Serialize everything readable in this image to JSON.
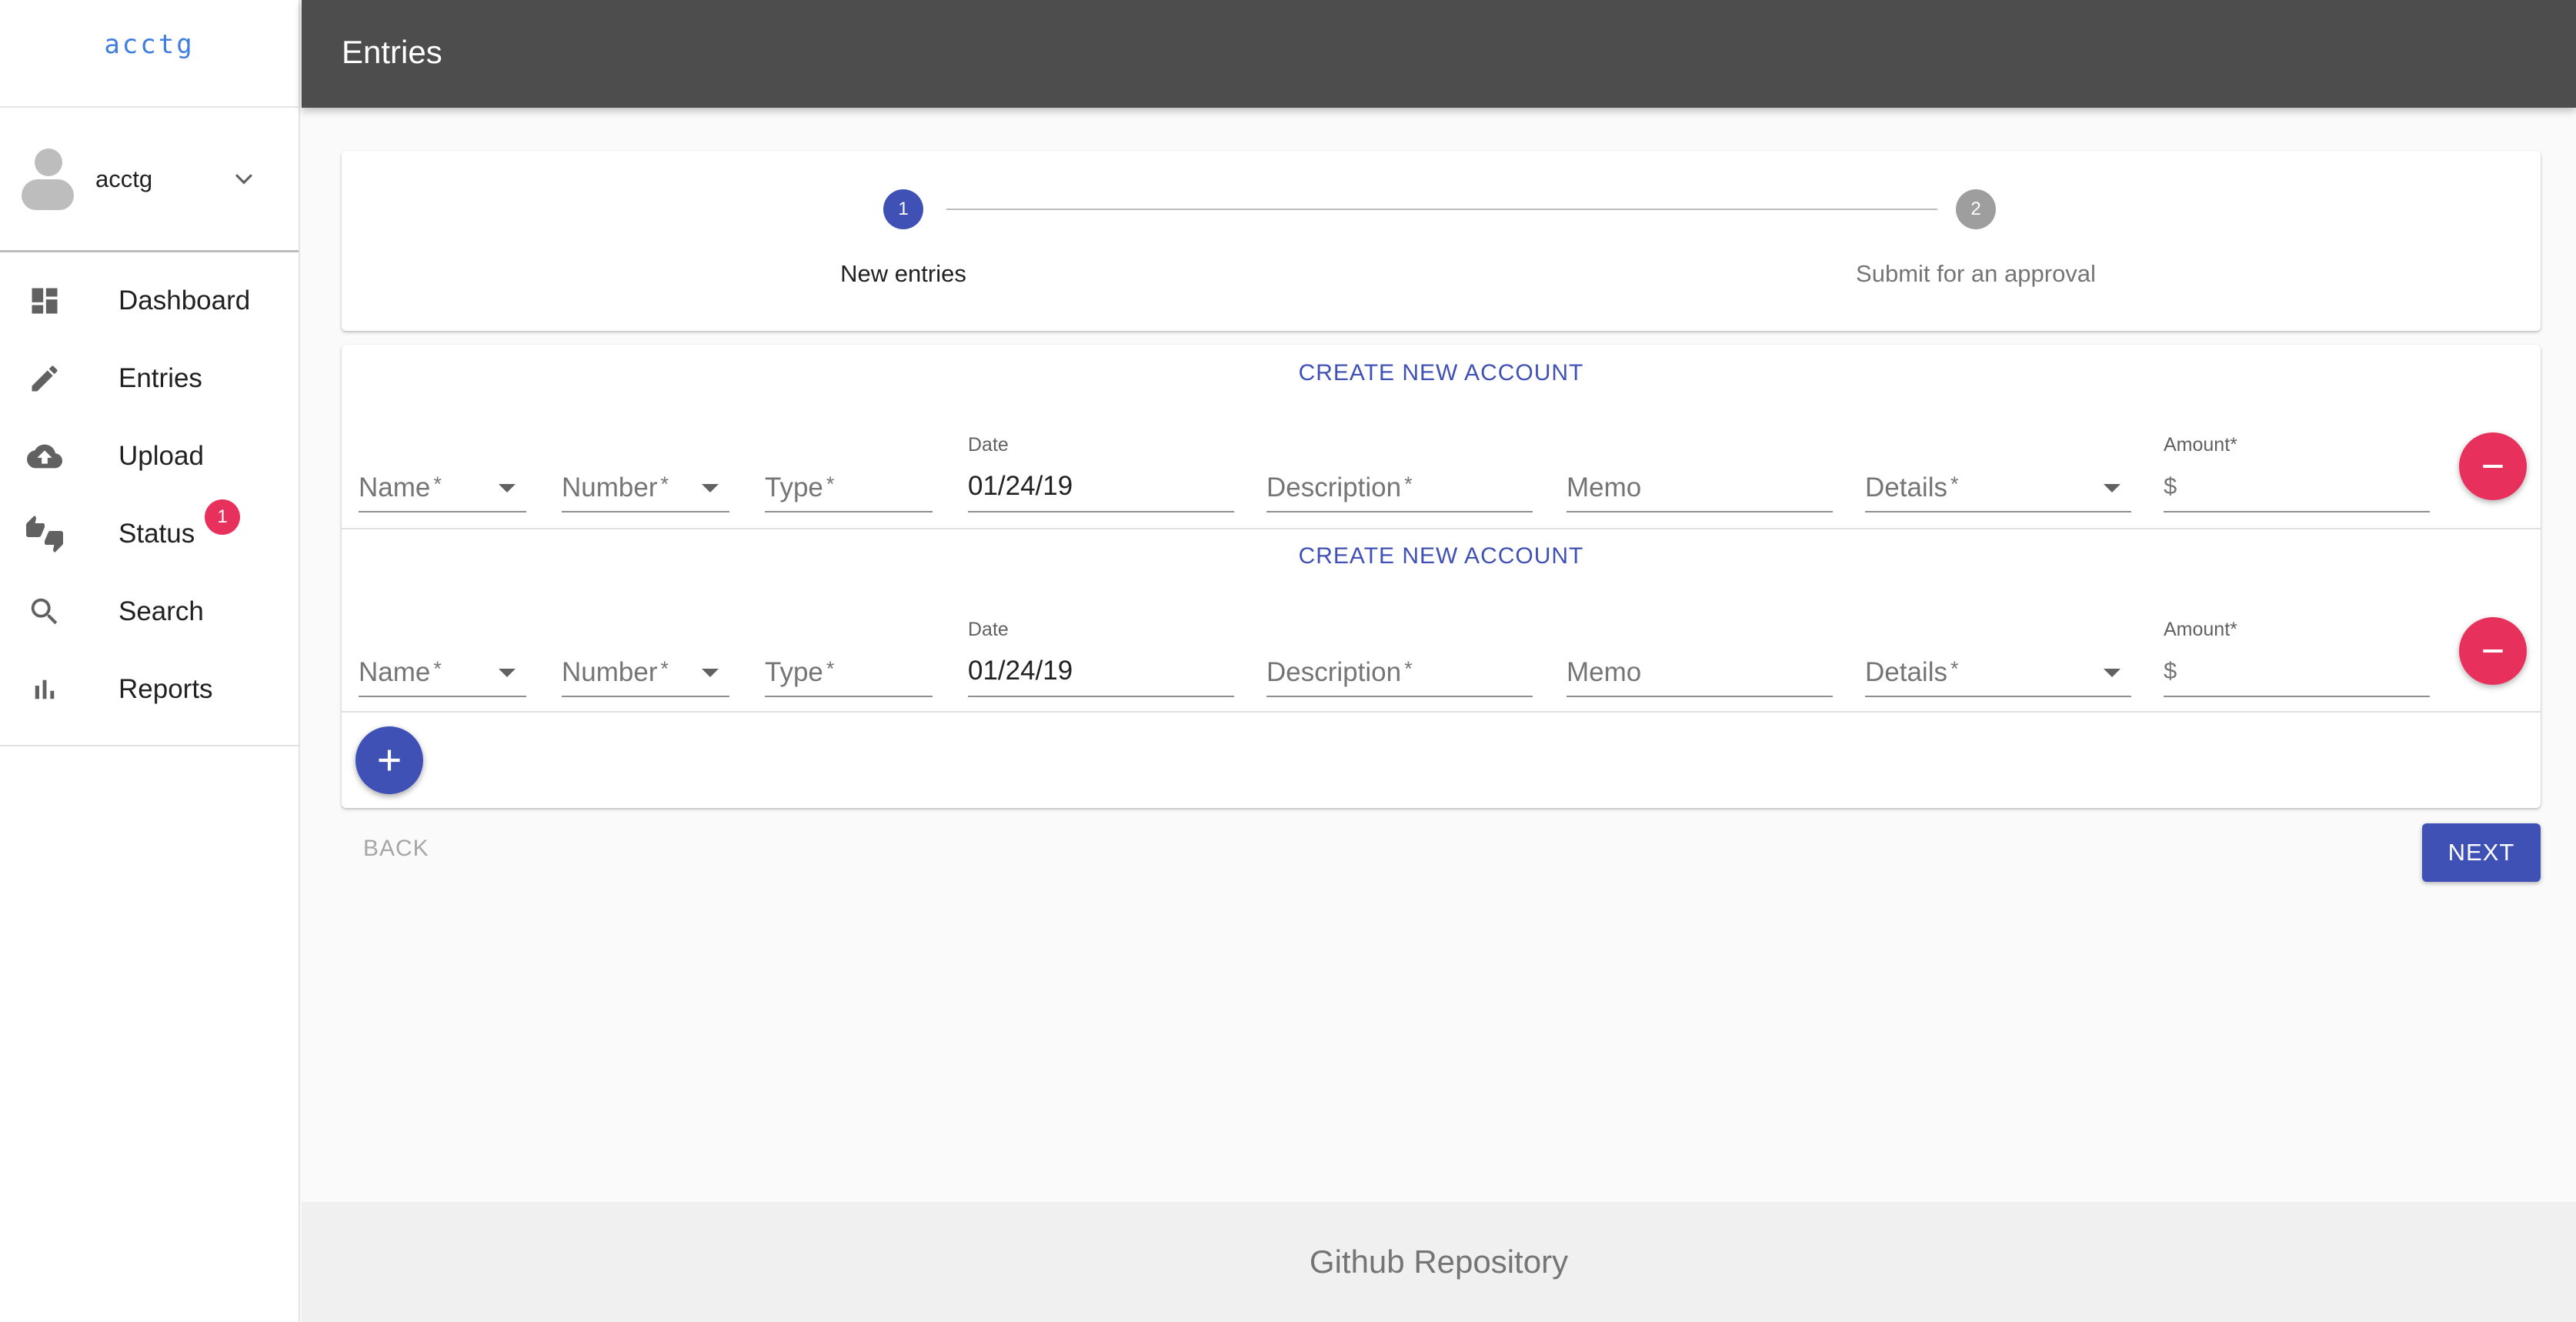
{
  "app": {
    "logo_text": "acctg"
  },
  "user": {
    "name": "acctg"
  },
  "sidebar": {
    "items": [
      {
        "label": "Dashboard",
        "icon": "dashboard-icon"
      },
      {
        "label": "Entries",
        "icon": "edit-icon"
      },
      {
        "label": "Upload",
        "icon": "cloud-upload-icon"
      },
      {
        "label": "Status",
        "icon": "thumbs-up-down-icon",
        "badge": "1"
      },
      {
        "label": "Search",
        "icon": "search-icon"
      },
      {
        "label": "Reports",
        "icon": "bar-chart-icon"
      }
    ]
  },
  "header": {
    "title": "Entries"
  },
  "stepper": {
    "steps": [
      {
        "number": "1",
        "label": "New entries",
        "active": true
      },
      {
        "number": "2",
        "label": "Submit for an approval",
        "active": false
      }
    ]
  },
  "entries": {
    "create_account_label": "CREATE NEW ACCOUNT",
    "rows": [
      {
        "name_placeholder": "Name",
        "number_placeholder": "Number",
        "type_placeholder": "Type",
        "date_label": "Date",
        "date_value": "01/24/19",
        "description_placeholder": "Description",
        "memo_placeholder": "Memo",
        "details_placeholder": "Details",
        "amount_label": "Amount",
        "currency_symbol": "$"
      },
      {
        "name_placeholder": "Name",
        "number_placeholder": "Number",
        "type_placeholder": "Type",
        "date_label": "Date",
        "date_value": "01/24/19",
        "description_placeholder": "Description",
        "memo_placeholder": "Memo",
        "details_placeholder": "Details",
        "amount_label": "Amount",
        "currency_symbol": "$"
      }
    ],
    "required_marker": "*"
  },
  "actions": {
    "back_label": "BACK",
    "next_label": "NEXT"
  },
  "footer": {
    "link_label": "Github Repository"
  },
  "colors": {
    "primary": "#3f51b5",
    "danger": "#e8305d",
    "appbar": "#4d4d4d"
  }
}
